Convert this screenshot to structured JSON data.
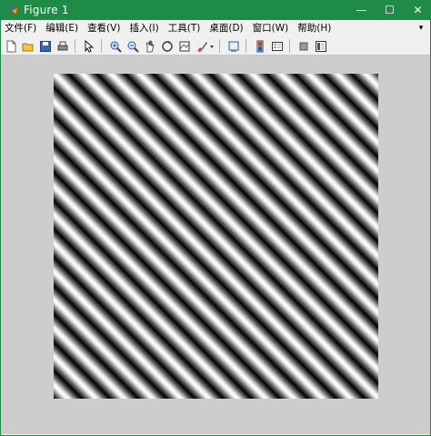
{
  "window": {
    "title": "Figure 1",
    "controls": {
      "minimize": "—",
      "maximize": "☐",
      "close": "✕"
    },
    "titlebar_color": "#1e8c47"
  },
  "menubar": {
    "items": [
      {
        "label": "文件(F)"
      },
      {
        "label": "编辑(E)"
      },
      {
        "label": "查看(V)"
      },
      {
        "label": "插入(I)"
      },
      {
        "label": "工具(T)"
      },
      {
        "label": "桌面(D)"
      },
      {
        "label": "窗口(W)"
      },
      {
        "label": "帮助(H)"
      }
    ],
    "overflow_arrow": "▾"
  },
  "toolbar": {
    "buttons": [
      "new-figure-icon",
      "open-file-icon",
      "save-icon",
      "print-icon",
      "edit-plot-arrow-icon",
      "zoom-in-icon",
      "zoom-out-icon",
      "pan-hand-icon",
      "rotate-3d-icon",
      "data-cursor-icon",
      "brush-icon",
      "link-plot-icon",
      "insert-colorbar-icon",
      "insert-legend-icon",
      "hide-plot-tools-icon",
      "show-plot-tools-icon"
    ]
  },
  "figure": {
    "background_color": "#cdcdcd",
    "image": "diagonal-sinusoidal-grating"
  }
}
